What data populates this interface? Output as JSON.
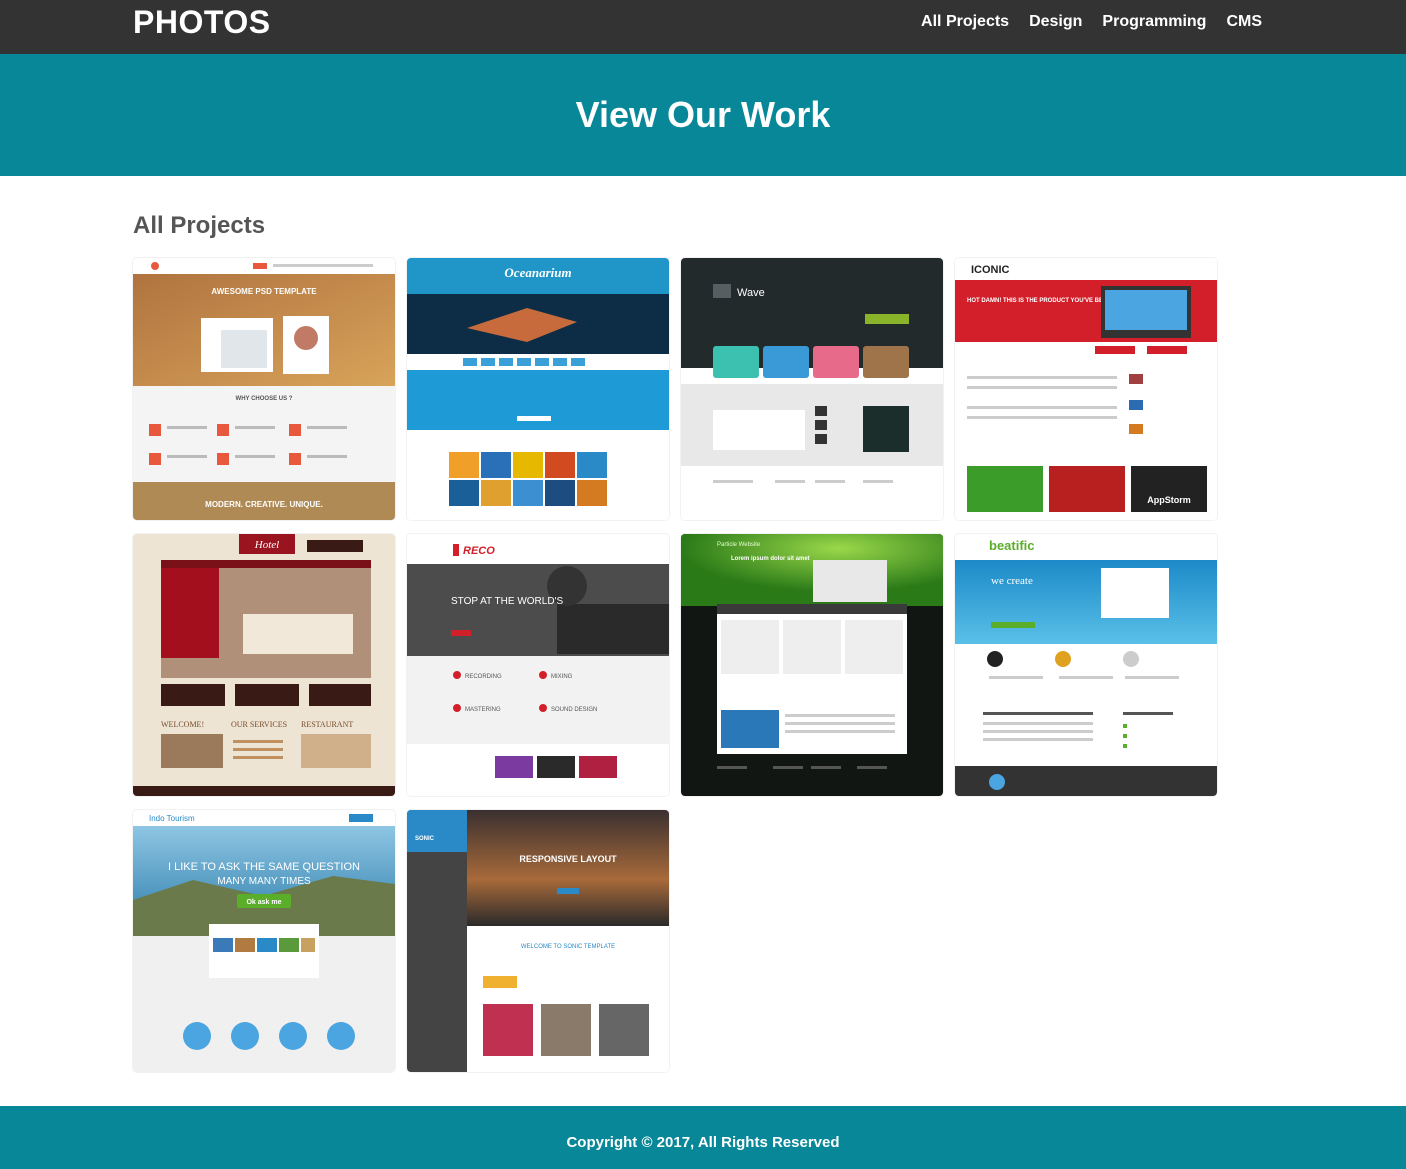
{
  "header": {
    "logo": "PHOTOS",
    "nav": [
      "All Projects",
      "Design",
      "Programming",
      "CMS"
    ]
  },
  "hero": {
    "title": "View Our Work"
  },
  "section": {
    "title": "All Projects"
  },
  "projects": [
    {
      "title": "AWESOME PSD TEMPLATE",
      "subtitle": "MODERN. CREATIVE. UNIQUE.",
      "mid": "WHY CHOOSE US ?"
    },
    {
      "title": "Oceanarium"
    },
    {
      "title": "Wave"
    },
    {
      "title": "ICONIC",
      "headline": "HOT DAMN! THIS IS THE PRODUCT YOU'VE BEEN WAITING FOR",
      "brand": "AppStorm"
    },
    {
      "title": "Hotel",
      "sections": [
        "WELCOME!",
        "OUR SERVICES",
        "RESTAURANT"
      ]
    },
    {
      "title": "RECO",
      "headline": "STOP AT THE WORLD'S",
      "items": [
        "RECORDING",
        "MIXING",
        "MASTERING",
        "SOUND DESIGN"
      ]
    },
    {
      "title": "Particle Website",
      "headline": "Lorem ipsum dolor sit amet"
    },
    {
      "title": "beatific",
      "headline": "we create"
    },
    {
      "title": "Indo Tourism",
      "headline": "I LIKE TO ASK THE SAME QUESTION",
      "subline": "MANY MANY TIMES",
      "button": "Ok ask me"
    },
    {
      "title": "SONIC",
      "headline": "RESPONSIVE LAYOUT",
      "subline": "WELCOME TO SONIC TEMPLATE"
    }
  ],
  "footer": {
    "copyright": "Copyright © 2017, All Rights Reserved"
  }
}
